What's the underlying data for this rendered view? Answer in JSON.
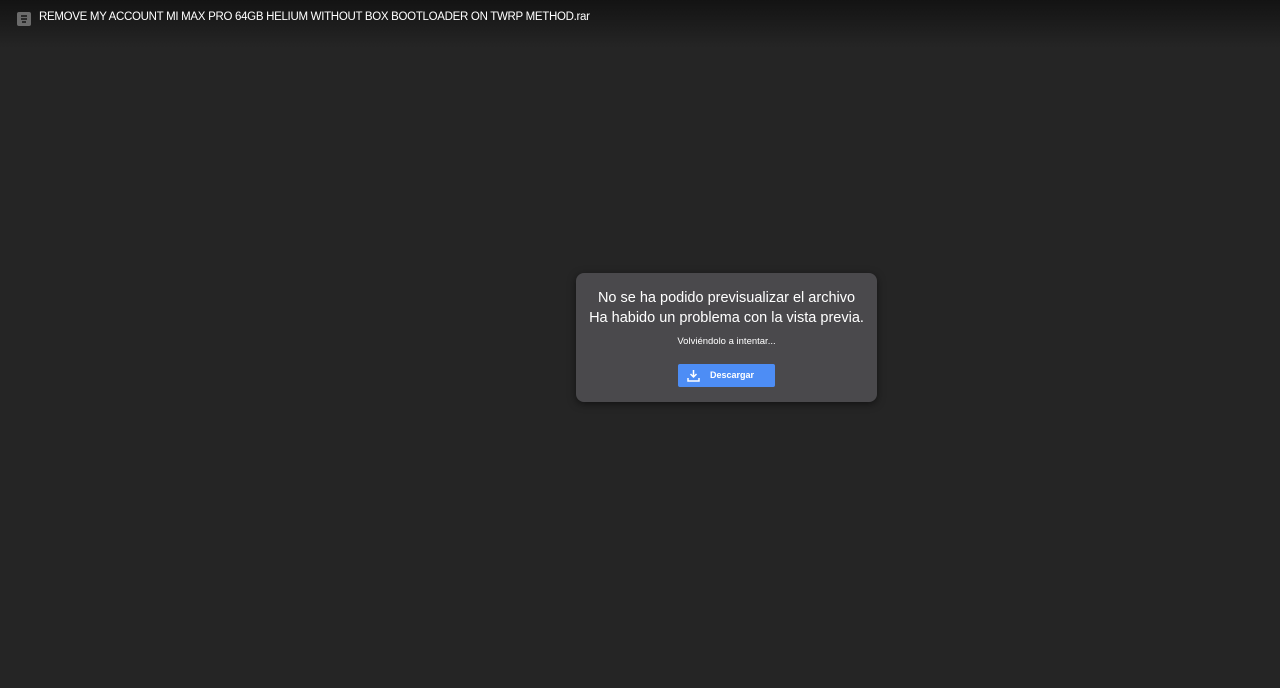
{
  "header": {
    "file_icon": "archive-file-icon",
    "title": "REMOVE MY ACCOUNT MI MAX PRO 64GB HELIUM WITHOUT BOX BOOTLOADER ON TWRP METHOD.rar"
  },
  "dialog": {
    "line1": "No se ha podido previsualizar el archivo",
    "line2": "Ha habido un problema con la vista previa.",
    "status": "Volviéndolo a intentar...",
    "download_label": "Descargar",
    "download_icon": "download-icon",
    "accent": "#4d8df5"
  }
}
